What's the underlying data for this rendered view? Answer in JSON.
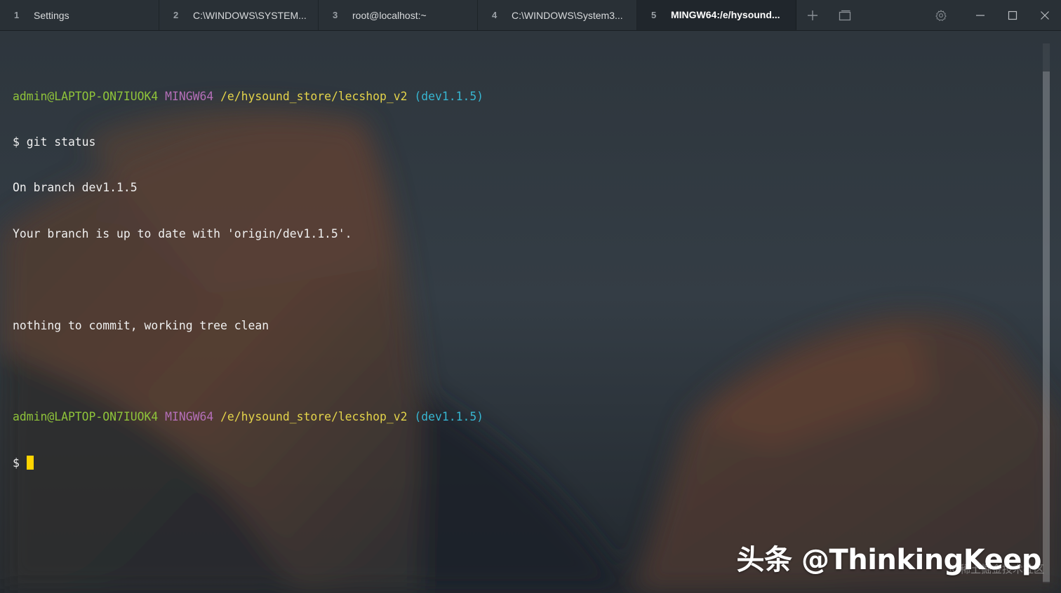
{
  "tabs": [
    {
      "number": "1",
      "title": "Settings"
    },
    {
      "number": "2",
      "title": "C:\\WINDOWS\\SYSTEM..."
    },
    {
      "number": "3",
      "title": "root@localhost:~"
    },
    {
      "number": "4",
      "title": "C:\\WINDOWS\\System3..."
    },
    {
      "number": "5",
      "title": "MINGW64:/e/hysound...",
      "active": true
    }
  ],
  "icons": {
    "new_tab": "plus-icon",
    "split": "split-pane-icon",
    "settings": "gear-icon",
    "minimize": "minimize-icon",
    "maximize": "maximize-icon",
    "close": "close-icon"
  },
  "terminal": {
    "prompt1": {
      "user_host": "admin@LAPTOP-ON7IUOK4",
      "system": "MINGW64",
      "path": "/e/hysound_store/lecshop_v2",
      "branch": "(dev1.1.5)"
    },
    "command1": "$ git status",
    "output": [
      "On branch dev1.1.5",
      "Your branch is up to date with 'origin/dev1.1.5'.",
      "",
      "nothing to commit, working tree clean",
      ""
    ],
    "prompt2": {
      "user_host": "admin@LAPTOP-ON7IUOK4",
      "system": "MINGW64",
      "path": "/e/hysound_store/lecshop_v2",
      "branch": "(dev1.1.5)"
    },
    "prompt_symbol": "$ "
  },
  "colors": {
    "user_host": "#8fc43a",
    "system": "#b46fb8",
    "path": "#e4d44a",
    "branch": "#37b6d1",
    "cursor": "#ffd400"
  },
  "watermark": {
    "main": "头条 @ThinkingKeep",
    "secondary": "@稀土掘金技术社区"
  }
}
